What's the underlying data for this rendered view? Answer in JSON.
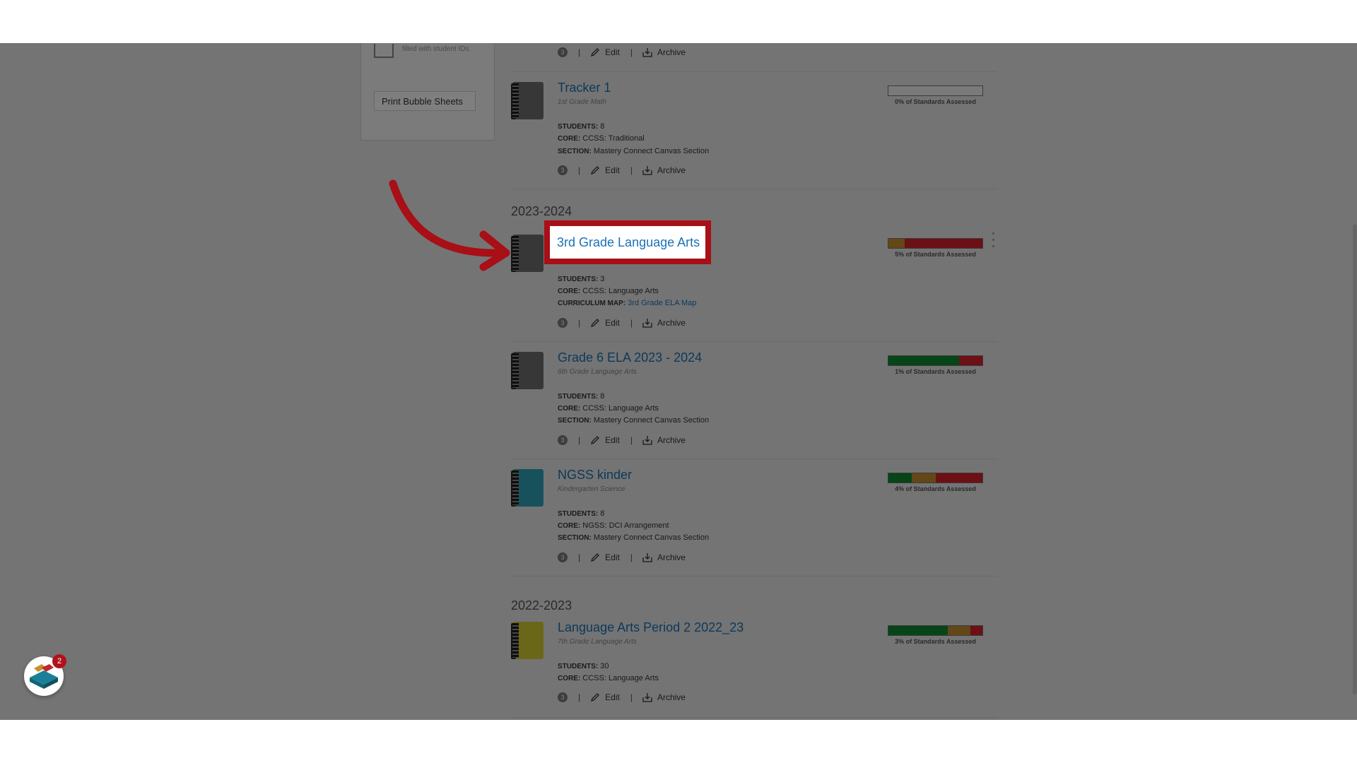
{
  "sidebar": {
    "hint": "filled with student IDs.",
    "print_button": "Print Bubble Sheets"
  },
  "labels": {
    "students": "STUDENTS:",
    "core": "CORE:",
    "section": "SECTION:",
    "curriculum_map": "CURRICULUM MAP:",
    "badge": "3",
    "separator": "|",
    "edit": "Edit",
    "archive": "Archive"
  },
  "years": [
    "2023-2024",
    "2022-2023"
  ],
  "trackers": [
    {
      "title": "Tracker 1",
      "subtitle": "1st Grade Math",
      "students": "8",
      "core": "CCSS: Traditional",
      "section": "Mastery Connect Canvas Section",
      "progress_label": "0% of Standards Assessed",
      "segments": [],
      "notebook_color": "#6f6f6f"
    },
    {
      "title": "3rd Grade Language Arts",
      "subtitle": "",
      "students": "3",
      "core": "CCSS: Language Arts",
      "curriculum_map": "3rd Grade ELA Map",
      "progress_label": "5% of Standards Assessed",
      "segments": [
        {
          "color": "#c98e2f",
          "fraction": 0.17
        },
        {
          "color": "#d8202a",
          "fraction": 0.83
        }
      ],
      "notebook_color": "#6f6f6f"
    },
    {
      "title": "Grade 6 ELA 2023 - 2024",
      "subtitle": "6th Grade Language Arts",
      "students": "8",
      "core": "CCSS: Language Arts",
      "section": "Mastery Connect Canvas Section",
      "progress_label": "1% of Standards Assessed",
      "segments": [
        {
          "color": "#0d8a31",
          "fraction": 0.75
        },
        {
          "color": "#d8202a",
          "fraction": 0.25
        }
      ],
      "notebook_color": "#6f6f6f"
    },
    {
      "title": "NGSS kinder",
      "subtitle": "Kindergarten Science",
      "students": "8",
      "core": "NGSS: DCI Arrangement",
      "section": "Mastery Connect Canvas Section",
      "progress_label": "4% of Standards Assessed",
      "segments": [
        {
          "color": "#0d8a31",
          "fraction": 0.25
        },
        {
          "color": "#c98e2f",
          "fraction": 0.25
        },
        {
          "color": "#d8202a",
          "fraction": 0.5
        }
      ],
      "notebook_color": "#2fa5b8"
    },
    {
      "title": "Language Arts Period 2 2022_23",
      "subtitle": "7th Grade Language Arts",
      "students": "30",
      "core": "CCSS: Language Arts",
      "progress_label": "3% of Standards Assessed",
      "segments": [
        {
          "color": "#0d8a31",
          "fraction": 0.63
        },
        {
          "color": "#c98e2f",
          "fraction": 0.24
        },
        {
          "color": "#d8202a",
          "fraction": 0.13
        }
      ],
      "notebook_color": "#d6cf33"
    }
  ],
  "app_launcher": {
    "badge_count": "2"
  },
  "colors": {
    "link": "#1b72b4",
    "highlight": "#a80f16",
    "overlay": "rgba(0,0,0,0.5)"
  }
}
